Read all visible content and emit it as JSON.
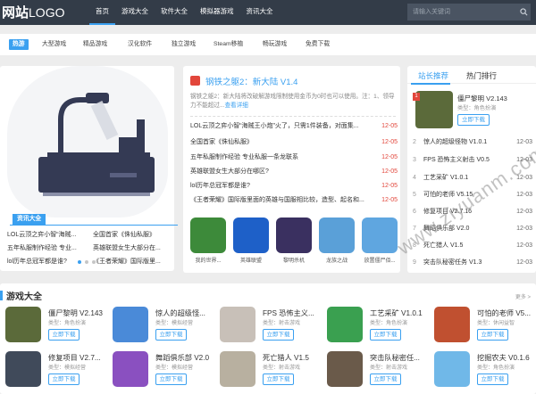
{
  "header": {
    "logo_bold": "网站",
    "logo_light": "LOGO",
    "nav": [
      "首页",
      "游戏大全",
      "软件大全",
      "模拟器游戏",
      "资讯大全"
    ],
    "search_placeholder": "请输入关键词"
  },
  "categories": [
    "热游",
    "大型游戏",
    "精品游戏",
    "汉化软件",
    "独立游戏",
    "Steam移植",
    "畅玩游戏",
    "免费下载"
  ],
  "zixun": {
    "title": "资讯大全",
    "items": [
      "LOL云顶之弈小智“海贼...",
      "全国首家《侏仙私服》",
      "五年私服制作经验 专业...",
      "英雄联盟女生大部分在...",
      "lol历年总冠军都是谁?",
      "《王者荣耀》国际版里..."
    ]
  },
  "news": {
    "title": "钢铁之躯2：新大陆 V1.4",
    "desc": "钢铁之躯2：新大陆将改破解游戏限制使用金币为0时也可以使用。注：1、领导力不能超过...",
    "more": "查看详细",
    "list": [
      {
        "t": "LOL云顶之弈小智“海贼王小炮”火了，只需1件装备，对面集...",
        "d": "12-05"
      },
      {
        "t": "全国首家《侏仙私服》",
        "d": "12-05"
      },
      {
        "t": "五年私服制作经验 专业私服一条龙联系",
        "d": "12-05"
      },
      {
        "t": "英雄联盟女生大部分在哪区?",
        "d": "12-05"
      },
      {
        "t": "lol历年总冠军都是谁?",
        "d": "12-05"
      },
      {
        "t": "《王者荣耀》国际版里面的英雄与国服相比较，造型、起名和...",
        "d": "12-05"
      }
    ],
    "games": [
      {
        "name": "我的世界...",
        "color": "#3d8a3a"
      },
      {
        "name": "英雄联盟",
        "color": "#1e60c8"
      },
      {
        "name": "黎明杀机",
        "color": "#3a3060"
      },
      {
        "name": "龙族之战",
        "color": "#5aa0d8"
      },
      {
        "name": "放置僵尸佰...",
        "color": "#5fa6e0"
      }
    ]
  },
  "rank": {
    "tabs": [
      "站长推荐",
      "热门排行"
    ],
    "top": {
      "no": "1",
      "name": "僵尸黎明 V2.143",
      "type": "类型：角色扮演",
      "btn": "立即下载"
    },
    "items": [
      {
        "n": "2",
        "t": "惊人的超级怪物 V1.0.1",
        "d": "12-03"
      },
      {
        "n": "3",
        "t": "FPS 恐怖主义射击 V0.5",
        "d": "12-03"
      },
      {
        "n": "4",
        "t": "工艺采矿 V1.0.1",
        "d": "12-03"
      },
      {
        "n": "5",
        "t": "可怕的老师 V5.15",
        "d": "12-03"
      },
      {
        "n": "6",
        "t": "修复项目 V2.7.16",
        "d": "12-03"
      },
      {
        "n": "7",
        "t": "舞蹈俱乐部 V2.0",
        "d": "12-03"
      },
      {
        "n": "8",
        "t": "死亡猎人 V1.5",
        "d": "12-03"
      },
      {
        "n": "9",
        "t": "突击队秘密任务 V1.3",
        "d": "12-03"
      }
    ]
  },
  "games": {
    "title": "游戏大全",
    "more": "更多 >",
    "btn": "立即下载",
    "items": [
      {
        "name": "僵尸黎明 V2.143",
        "type": "类型：角色扮演",
        "color": "#5b6a3a"
      },
      {
        "name": "惊人的超级怪...",
        "type": "类型：模拟经营",
        "color": "#4a8ad8"
      },
      {
        "name": "FPS 恐怖主义...",
        "type": "类型：射击游戏",
        "color": "#c8c0b8"
      },
      {
        "name": "工艺采矿 V1.0.1",
        "type": "类型：角色扮演",
        "color": "#3aa050"
      },
      {
        "name": "可怕的老师 V5...",
        "type": "类型：休闲益智",
        "color": "#c05030"
      },
      {
        "name": "修复项目 V2.7...",
        "type": "类型：模拟经营",
        "color": "#404a5a"
      },
      {
        "name": "舞蹈俱乐部 V2.0",
        "type": "类型：模拟经营",
        "color": "#8a50c0"
      },
      {
        "name": "死亡猎人 V1.5",
        "type": "类型：射击游戏",
        "color": "#b8b0a0"
      },
      {
        "name": "突击队秘密任...",
        "type": "类型：射击游戏",
        "color": "#6a5a4a"
      },
      {
        "name": "挖掘农夫 V0.1.6",
        "type": "类型：角色扮演",
        "color": "#70b8e8"
      }
    ]
  },
  "watermark": "www.ziyuanm.com"
}
